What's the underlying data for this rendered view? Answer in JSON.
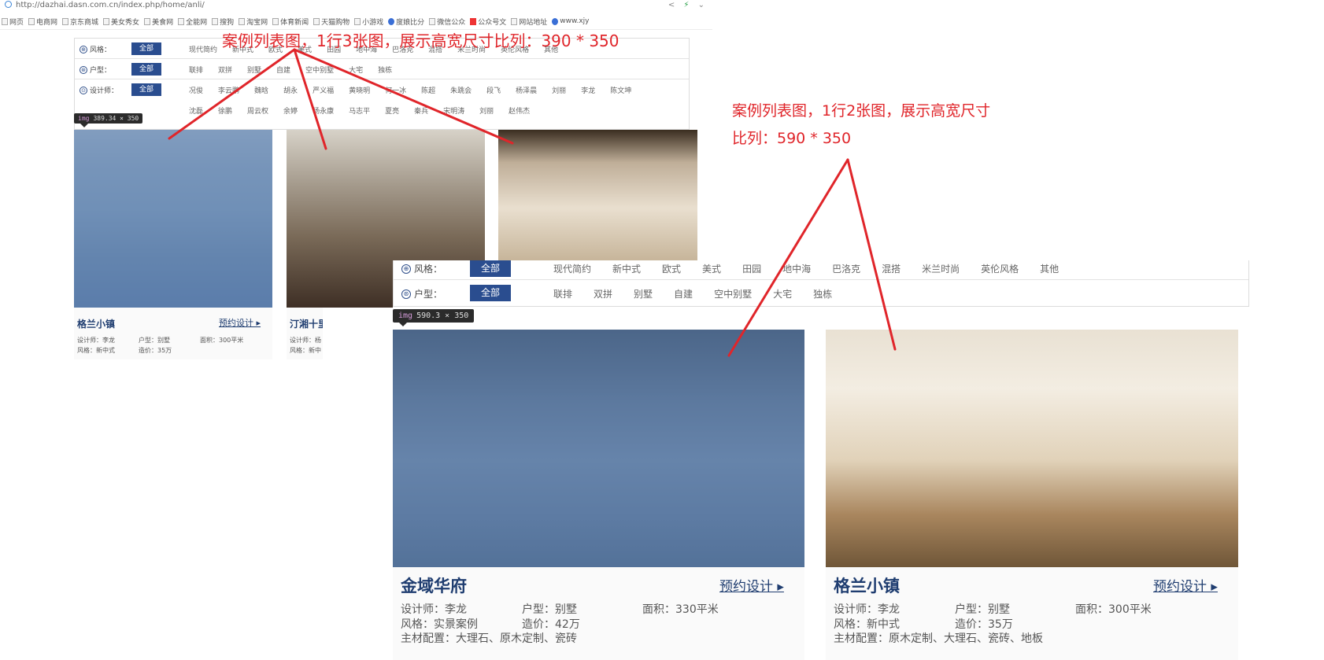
{
  "browser": {
    "url": "http://dazhai.dasn.com.cn/index.php/home/anli/",
    "bookmarks": [
      "网页",
      "电商网",
      "京东商城",
      "美女秀女",
      "美食网",
      "全能网",
      "搜狗",
      "淘宝网",
      "体育新闻",
      "天猫购物",
      "小游戏",
      "度娘比分",
      "微信公众",
      "公众号文",
      "网站地址",
      "www.xjy"
    ]
  },
  "filter": {
    "style_label": "风格：",
    "house_label": "户型：",
    "designer_label": "设计师：",
    "all_label": "全部",
    "styles": [
      "现代简约",
      "新中式",
      "欧式",
      "美式",
      "田园",
      "地中海",
      "巴洛克",
      "混搭",
      "米兰时尚",
      "英伦风格",
      "其他"
    ],
    "house_types": [
      "联排",
      "双拼",
      "别墅",
      "自建",
      "空中别墅",
      "大宅",
      "独栋"
    ],
    "designers_row1": [
      "况俊",
      "李云鹏",
      "魏晗",
      "胡永",
      "严义福",
      "黄晓明",
      "何一冰",
      "陈超",
      "朱跳会",
      "段飞",
      "杨泽晨",
      "刘丽",
      "李龙",
      "陈文坤"
    ],
    "designers_row2": [
      "沈磊",
      "徐鹏",
      "周云权",
      "余婷",
      "杨永康",
      "马志平",
      "夏亮",
      "秦兵",
      "宋明涛",
      "刘丽",
      "赵伟杰"
    ]
  },
  "small_grid": {
    "tooltip_tag": "img",
    "tooltip_size": "389.34 × 350",
    "cards": [
      {
        "title": "格兰小镇",
        "book_label": "预约设计",
        "designer": "设计师：李龙",
        "house": "户型：别墅",
        "area": "面积：300平米",
        "style": "风格：新中式",
        "price": "造价：35万"
      },
      {
        "title": "汀湘十里",
        "designer": "设计师：杨",
        "style": "风格：新中"
      }
    ]
  },
  "big_grid": {
    "tooltip_tag": "img",
    "tooltip_size": "590.3 × 350",
    "cards": [
      {
        "title": "金域华府",
        "book_label": "预约设计",
        "designer": "设计师：李龙",
        "house": "户型：别墅",
        "area": "面积：330平米",
        "style": "风格：实景案例",
        "price": "造价：42万",
        "materials": "主材配置：大理石、原木定制、瓷砖"
      },
      {
        "title": "格兰小镇",
        "book_label": "预约设计",
        "designer": "设计师：李龙",
        "house": "户型：别墅",
        "area": "面积：300平米",
        "style": "风格：新中式",
        "price": "造价：35万",
        "materials": "主材配置：原木定制、大理石、瓷砖、地板"
      }
    ]
  },
  "annotations": {
    "top": "案例列表图，1行3张图，展示高宽尺寸比列：390 * 350",
    "right_line1": "案例列表图，1行2张图，展示高宽尺寸",
    "right_line2": "比列：590 * 350"
  },
  "colors": {
    "accent": "#2a4d8f",
    "title": "#1f3d70",
    "annotation": "#e0252a"
  }
}
